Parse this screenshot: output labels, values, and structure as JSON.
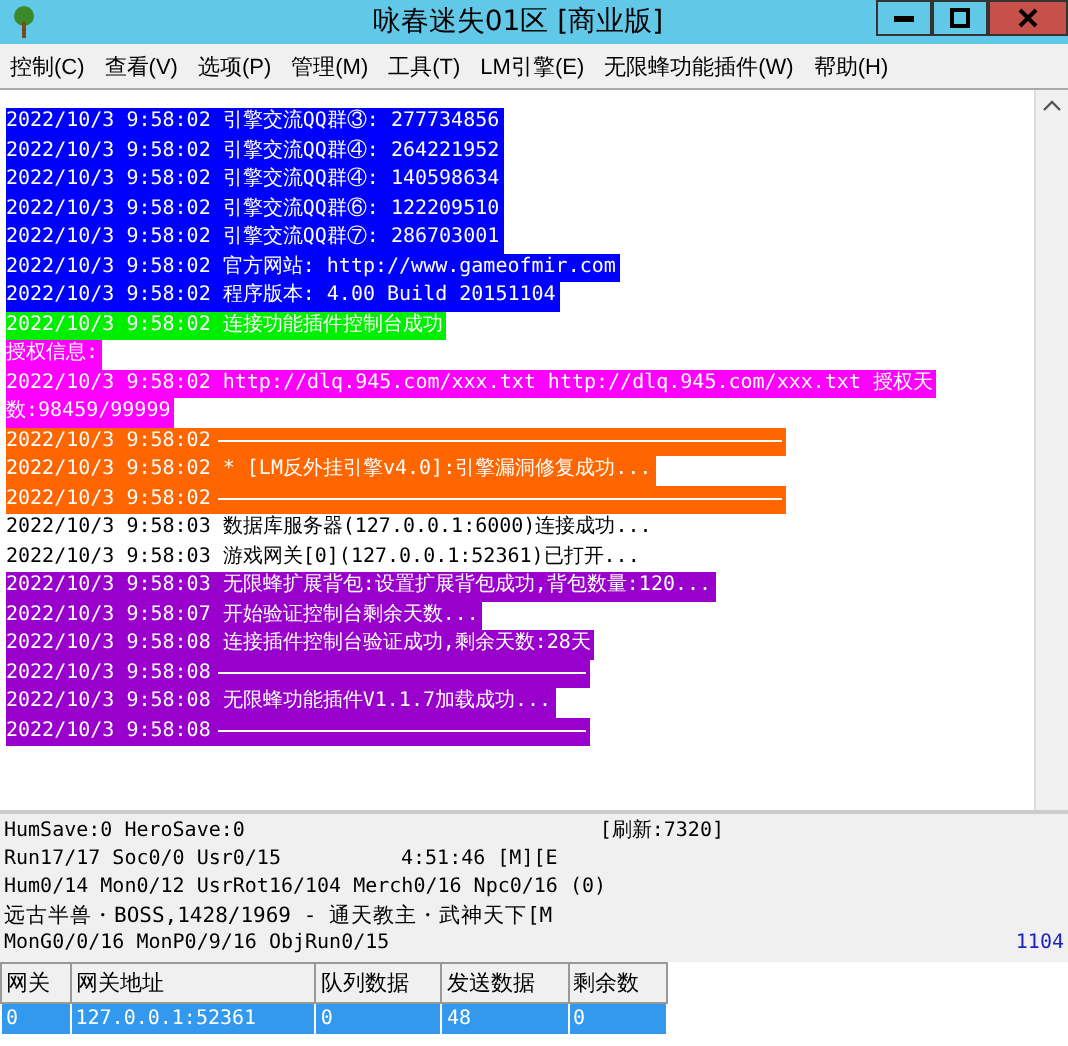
{
  "window": {
    "title": "咏春迷失01区 [商业版]"
  },
  "menu": [
    "控制(C)",
    "查看(V)",
    "选项(P)",
    "管理(M)",
    "工具(T)",
    "LM引擎(E)",
    "无限蜂功能插件(W)",
    "帮助(H)"
  ],
  "log": [
    {
      "kind": "text",
      "time": "2022/10/3 9:58:02",
      "text": "引擎交流QQ群③: 277734856",
      "color": "#0000ff"
    },
    {
      "kind": "text",
      "time": "2022/10/3 9:58:02",
      "text": "引擎交流QQ群④: 264221952",
      "color": "#0000ff"
    },
    {
      "kind": "text",
      "time": "2022/10/3 9:58:02",
      "text": "引擎交流QQ群④: 140598634",
      "color": "#0000ff"
    },
    {
      "kind": "text",
      "time": "2022/10/3 9:58:02",
      "text": "引擎交流QQ群⑥: 122209510",
      "color": "#0000ff"
    },
    {
      "kind": "text",
      "time": "2022/10/3 9:58:02",
      "text": "引擎交流QQ群⑦: 286703001",
      "color": "#0000ff"
    },
    {
      "kind": "text",
      "time": "2022/10/3 9:58:02",
      "text": "官方网站: http://www.gameofmir.com",
      "color": "#0000ff"
    },
    {
      "kind": "text",
      "time": "2022/10/3 9:58:02",
      "text": "程序版本: 4.00 Build 20151104",
      "color": "#0000ff"
    },
    {
      "kind": "text",
      "time": "2022/10/3 9:58:02",
      "text": "连接功能插件控制台成功",
      "color": "#00ee00"
    },
    {
      "kind": "text",
      "text": "授权信息:",
      "color": "#ff00ff"
    },
    {
      "kind": "text",
      "time": "2022/10/3 9:58:02",
      "text": "http://dlq.945.com/xxx.txt http://dlq.945.com/xxx.txt 授权天",
      "color": "#ff00ff"
    },
    {
      "kind": "text",
      "text": "数:98459/99999",
      "color": "#ff00ff"
    },
    {
      "kind": "separator",
      "time": "2022/10/3 9:58:02",
      "color": "#ff6600"
    },
    {
      "kind": "text",
      "time": "2022/10/3 9:58:02",
      "text": "* [LM反外挂引擎v4.0]:引擎漏洞修复成功...",
      "color": "#ff6600"
    },
    {
      "kind": "separator",
      "time": "2022/10/3 9:58:02",
      "color": "#ff6600"
    },
    {
      "kind": "text",
      "time": "2022/10/3 9:58:03",
      "text": "数据库服务器(127.0.0.1:6000)连接成功...",
      "color": "#ffffff"
    },
    {
      "kind": "text",
      "time": "2022/10/3 9:58:03",
      "text": "游戏网关[0](127.0.0.1:52361)已打开...",
      "color": "#ffffff"
    },
    {
      "kind": "text",
      "time": "2022/10/3 9:58:03",
      "text": "无限蜂扩展背包:设置扩展背包成功,背包数量:120...",
      "color": "#9900cc"
    },
    {
      "kind": "text",
      "time": "2022/10/3 9:58:07",
      "text": "开始验证控制台剩余天数...",
      "color": "#9900cc"
    },
    {
      "kind": "text",
      "time": "2022/10/3 9:58:08",
      "text": "连接插件控制台验证成功,剩余天数:28天",
      "color": "#9900cc"
    },
    {
      "kind": "separator",
      "time": "2022/10/3 9:58:08",
      "color": "#9900cc"
    },
    {
      "kind": "text",
      "time": "2022/10/3 9:58:08",
      "text": "无限蜂功能插件V1.1.7加载成功...",
      "color": "#9900cc"
    },
    {
      "kind": "separator",
      "time": "2022/10/3 9:58:08",
      "color": "#9900cc"
    }
  ],
  "status": {
    "left": [
      "HumSave:0 HeroSave:0",
      "Run17/17 Soc0/0 Usr0/15",
      "Hum0/14 Mon0/12 UsrRot16/104 Merch0/16 Npc0/16 (0)",
      "远古半兽・BOSS,1428/1969 - 通天教主・武神天下[M",
      "MonG0/0/16 MonP0/9/16 ObjRun0/15"
    ],
    "refresh": "[刷新:7320]",
    "clock": "4:51:46 [M][E",
    "code": "1104"
  },
  "table": {
    "columns": [
      "网关",
      "网关地址",
      "队列数据",
      "发送数据",
      "剩余数"
    ],
    "rows": [
      {
        "selected": true,
        "cells": [
          "0",
          "127.0.0.1:52361",
          "0",
          "48",
          "0"
        ]
      }
    ]
  }
}
